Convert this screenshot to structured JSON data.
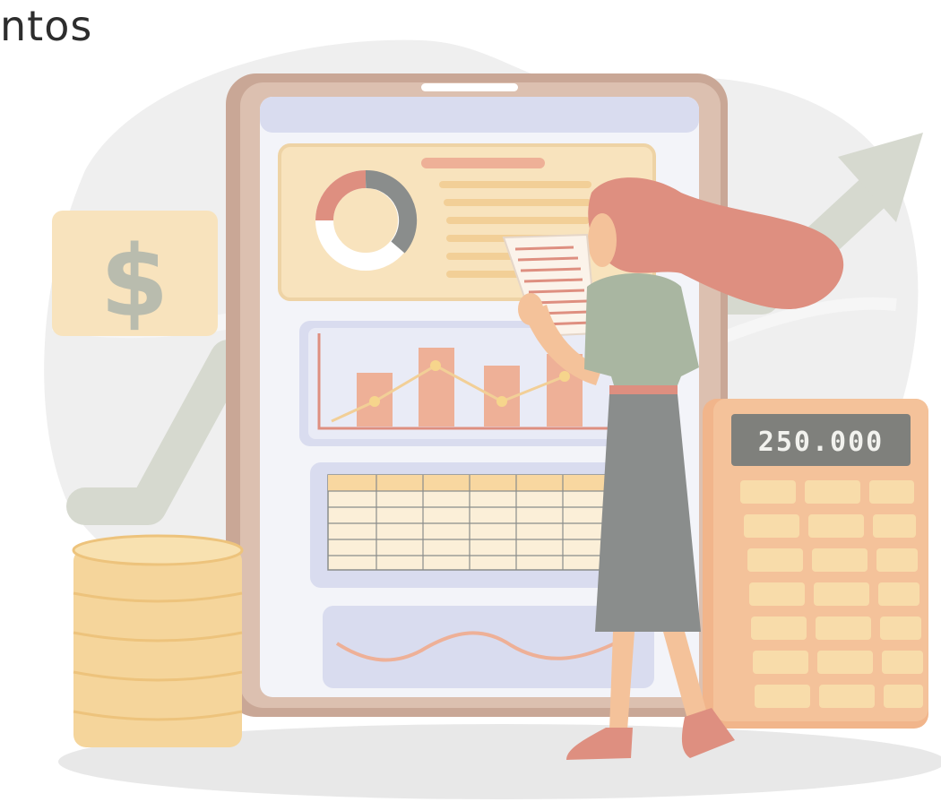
{
  "heading": "ntos",
  "illustration": {
    "dollar_symbol": "$",
    "calculator_display": "250.000"
  },
  "colors": {
    "background": "#ffffff",
    "heading_text": "#2d2d2d",
    "blob": "#efefef",
    "trend_arrow": "#d6d9cf",
    "tablet_frame": "#c9a796",
    "tablet_screen": "#f3f4f9",
    "screen_header": "#d9dcef",
    "dashboard_card": "#f8e3bd",
    "bar": "#eeb097",
    "calculator_body": "#f1b58b",
    "calculator_key": "#f8dcaa",
    "calculator_screen": "#7f807c",
    "calculator_digits": "#f2f2ee",
    "coins": "#f5d59b",
    "hair": "#de8f80",
    "shirt": "#a9b6a1",
    "skirt": "#8a8d8c",
    "skin": "#f4c29a",
    "shoes": "#de8f80"
  }
}
